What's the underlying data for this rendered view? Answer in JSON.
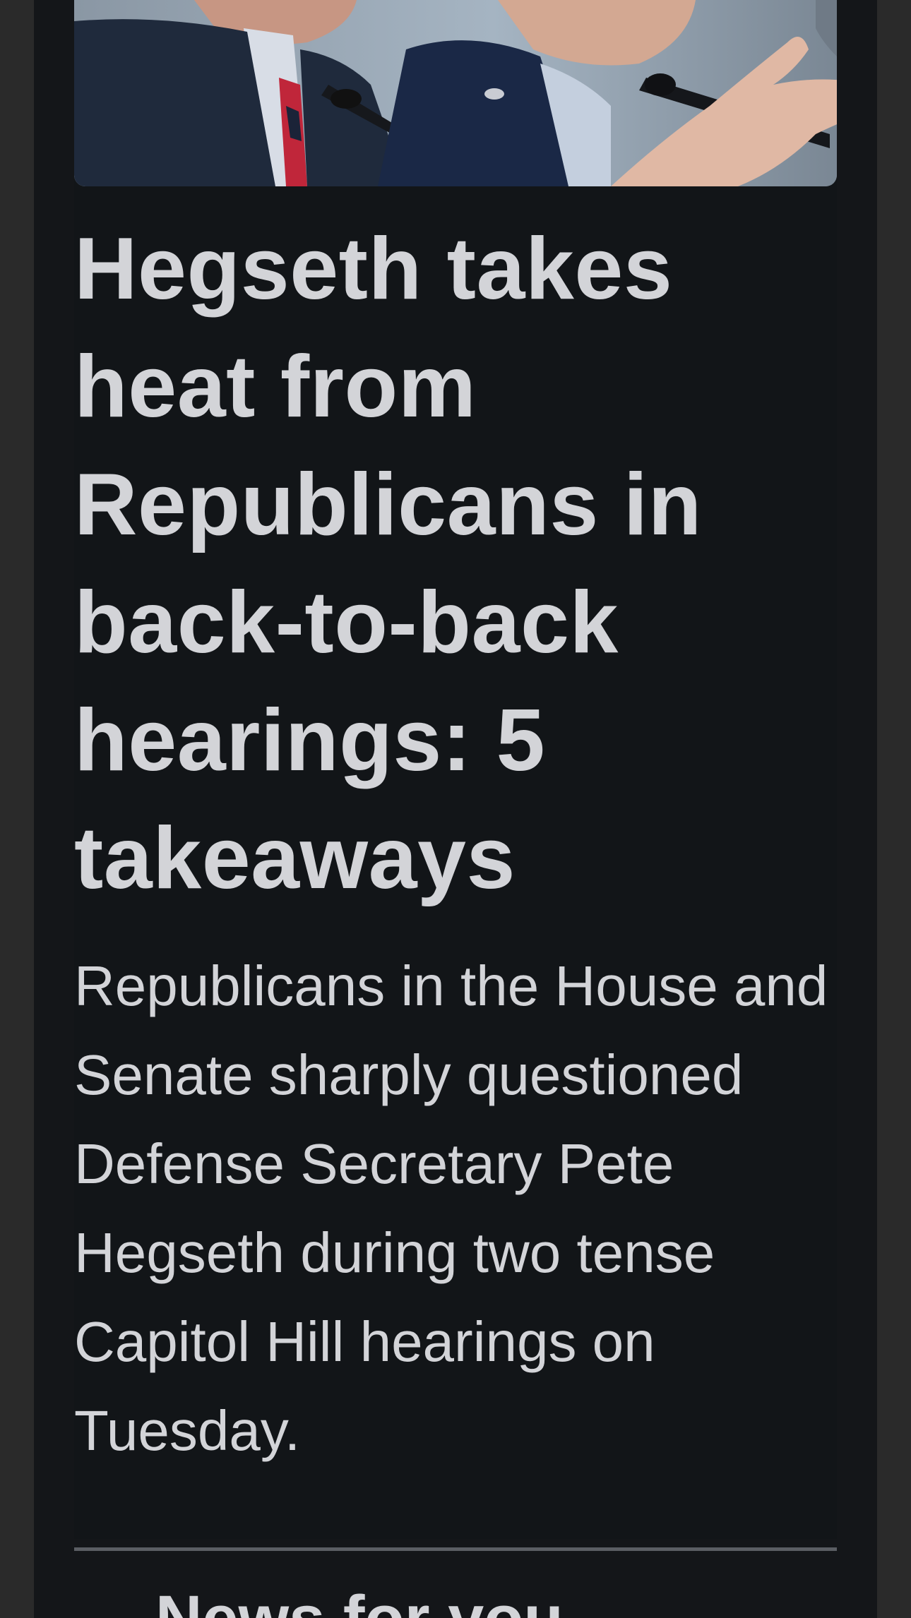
{
  "article": {
    "image_description": "Two men at a hearing table with microphones",
    "headline": "Hegseth takes heat from Republicans in back-to-back hearings: 5 takeaways",
    "summary": "Republicans in the House and Senate sharply questioned Defense Secretary Pete Hegseth during two tense Capitol Hill hearings on Tuesday."
  },
  "section": {
    "title": "News for you"
  },
  "colors": {
    "page_background": "#2a2a2a",
    "card_background": "#121518",
    "text": "#d3d4d8",
    "divider": "#5b5e63"
  }
}
